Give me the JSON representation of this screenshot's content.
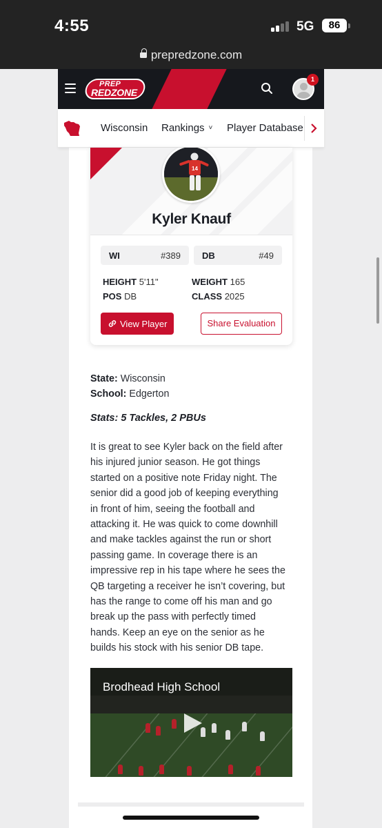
{
  "status_bar": {
    "time": "4:55",
    "network": "5G",
    "battery": "86"
  },
  "browser": {
    "url": "prepredzone.com"
  },
  "header": {
    "logo_line1": "PREP",
    "logo_line2": "REDZONE",
    "notification_count": "1",
    "accent_color": "#c8102e"
  },
  "nav": {
    "items": [
      {
        "label": "Wisconsin"
      },
      {
        "label": "Rankings",
        "suffix": "˅"
      },
      {
        "label": "Player Database"
      }
    ]
  },
  "player": {
    "name": "Kyler Knauf",
    "jersey": "14",
    "state_rank": {
      "label": "WI",
      "value": "#389"
    },
    "pos_rank": {
      "label": "DB",
      "value": "#49"
    },
    "height_label": "HEIGHT",
    "height_value": "5'11\"",
    "weight_label": "WEIGHT",
    "weight_value": "165",
    "pos_label": "POS",
    "pos_value": "DB",
    "class_label": "CLASS",
    "class_value": "2025",
    "view_button": "View Player",
    "share_button": "Share Evaluation"
  },
  "article": {
    "state_label": "State:",
    "state_value": "Wisconsin",
    "school_label": "School:",
    "school_value": "Edgerton",
    "stats": "Stats: 5 Tackles, 2 PBUs",
    "lines": [
      "It is great to see Kyler back on the field after",
      "his injured junior season. He got things",
      "started on a positive note Friday night. The",
      "senior did a good job of keeping everything",
      "in front of him, seeing the football and",
      "attacking it. He was quick to come downhill",
      "and make tackles against the run or short",
      "passing game. In coverage there is an",
      "impressive rep in his tape where he sees the",
      "QB targeting a receiver he isn’t covering, but",
      "has the range to come off his man and go",
      "break up the pass with perfectly timed",
      "hands. Keep an eye on the senior as he",
      "builds his stock with his senior DB tape."
    ]
  },
  "video": {
    "title": "Brodhead High School"
  }
}
